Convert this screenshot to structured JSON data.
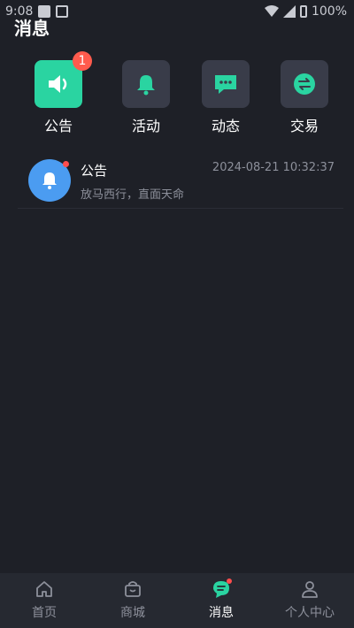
{
  "status_bar": {
    "time": "9:08",
    "battery": "100%"
  },
  "page": {
    "title": "消息"
  },
  "categories": [
    {
      "label": "公告",
      "badge": "1",
      "icon": "speaker-icon"
    },
    {
      "label": "活动",
      "icon": "bell-icon"
    },
    {
      "label": "动态",
      "icon": "chat-bubble-icon"
    },
    {
      "label": "交易",
      "icon": "exchange-icon"
    }
  ],
  "messages": [
    {
      "title": "公告",
      "time": "2024-08-21 10:32:37",
      "body": "放马西行，直面天命",
      "icon": "bell-icon"
    }
  ],
  "nav": [
    {
      "label": "首页",
      "icon": "home-icon"
    },
    {
      "label": "商城",
      "icon": "shopping-bag-icon"
    },
    {
      "label": "消息",
      "icon": "message-icon"
    },
    {
      "label": "个人中心",
      "icon": "person-icon"
    }
  ],
  "colors": {
    "background": "#1e2027",
    "accent": "#2ad4a1",
    "badge": "#ff5b4d",
    "avatar": "#4b9cf1",
    "muted_text": "#8d909b"
  }
}
